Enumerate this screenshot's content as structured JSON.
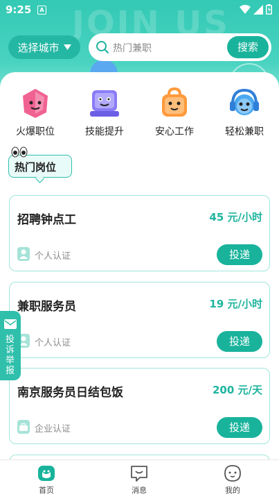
{
  "status_bar": {
    "time": "9:25",
    "notification_badge": "A"
  },
  "hero": {
    "background_text": "JOIN US"
  },
  "city_selector": {
    "label": "选择城市"
  },
  "search": {
    "placeholder": "热门兼职",
    "button_label": "搜索"
  },
  "categories": [
    {
      "label": "火爆职位",
      "icon": "fire-job-mascot-icon",
      "color": "#f06292"
    },
    {
      "label": "技能提升",
      "icon": "skill-mascot-icon",
      "color": "#8b7cf6"
    },
    {
      "label": "安心工作",
      "icon": "safe-work-bag-icon",
      "color": "#ff9a3c"
    },
    {
      "label": "轻松兼职",
      "icon": "easy-headphone-icon",
      "color": "#4aa8f0"
    }
  ],
  "section": {
    "title": "热门岗位"
  },
  "jobs": [
    {
      "title": "招聘钟点工",
      "pay": "45 元/小时",
      "cert": "个人认证",
      "cert_icon": "person-icon",
      "apply_label": "投递"
    },
    {
      "title": "兼职服务员",
      "pay": "19 元/小时",
      "cert": "个人认证",
      "cert_icon": "person-icon",
      "apply_label": "投递"
    },
    {
      "title": "南京服务员日结包饭",
      "pay": "200 元/天",
      "cert": "企业认证",
      "cert_icon": "briefcase-icon",
      "apply_label": "投递"
    }
  ],
  "report_tab": {
    "label": "投诉举报"
  },
  "tabbar": [
    {
      "label": "首页",
      "active": true
    },
    {
      "label": "消息",
      "active": false
    },
    {
      "label": "我的",
      "active": false
    }
  ],
  "colors": {
    "primary": "#19b39c",
    "accent_text": "#1fb49e",
    "card_border": "#9fe6da"
  }
}
